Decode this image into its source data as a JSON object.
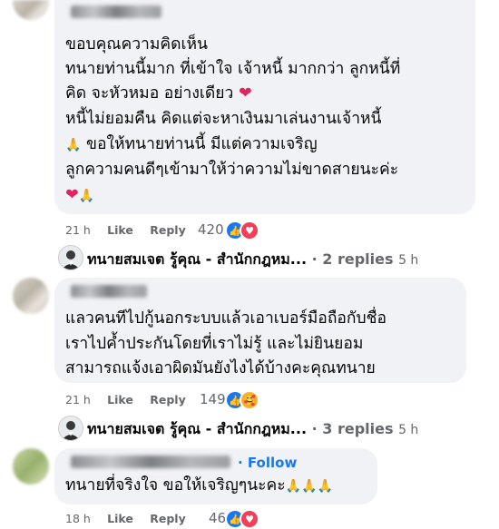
{
  "comments": [
    {
      "lines": [
        "ขอบคุณความคิดเห็น",
        "ทนายท่านนี้มาก ที่เข้าใจ เจ้าหนี้ มากกว่า ลูกหนี้ที่",
        "คิด จะหัวหมอ อย่างเดียว",
        "หนี้ไม่ยอมคืน คิดแต่จะหาเงินมาเล่นงานเจ้าหนี้",
        "ขอให้ทนายท่านนี้ มีแต่ความเจริญ",
        "ลูกความคนดีๆเข้ามาให้ว่าความไม่ขาดสายนะค่ะ"
      ],
      "time": "21 h",
      "like_label": "Like",
      "reply_label": "Reply",
      "reaction_count": "420",
      "reactions": [
        "like-icon",
        "love-icon"
      ]
    },
    {
      "lines": [
        "แลวคนทีไปกู้นอกระบบแล้วเอาเบอร์มือถือกับชื่อ",
        "เราไปค้ำประกันโดยที่เราไม่รู้ และไม่ยินยอม",
        "สามารถแจ้งเอาผิดมันยังไงได้บ้างคะคุณทนาย"
      ],
      "time": "21 h",
      "like_label": "Like",
      "reply_label": "Reply",
      "reaction_count": "149",
      "reactions": [
        "like-icon",
        "care-icon"
      ]
    },
    {
      "follow_label": "Follow",
      "lines": [
        "ทนายที่จริงใจ ขอให้เจริญๆนะคะ"
      ],
      "time": "18 h",
      "like_label": "Like",
      "reply_label": "Reply",
      "reaction_count": "46",
      "reactions": [
        "like-icon",
        "love-icon"
      ]
    }
  ],
  "replies": [
    {
      "name": "ทนายสมเจต รู้คุณ - สำนักกฎหม...",
      "dot": "·",
      "count_label": "2 replies",
      "time": "5 h"
    },
    {
      "name": "ทนายสมเจต รู้คุณ - สำนักกฎหม...",
      "dot": "·",
      "count_label": "3 replies",
      "time": "5 h"
    }
  ],
  "colors": {
    "bubble": "#f0f2f5",
    "muted": "#65676b",
    "link": "#1877f2",
    "love": "#f33e58"
  }
}
